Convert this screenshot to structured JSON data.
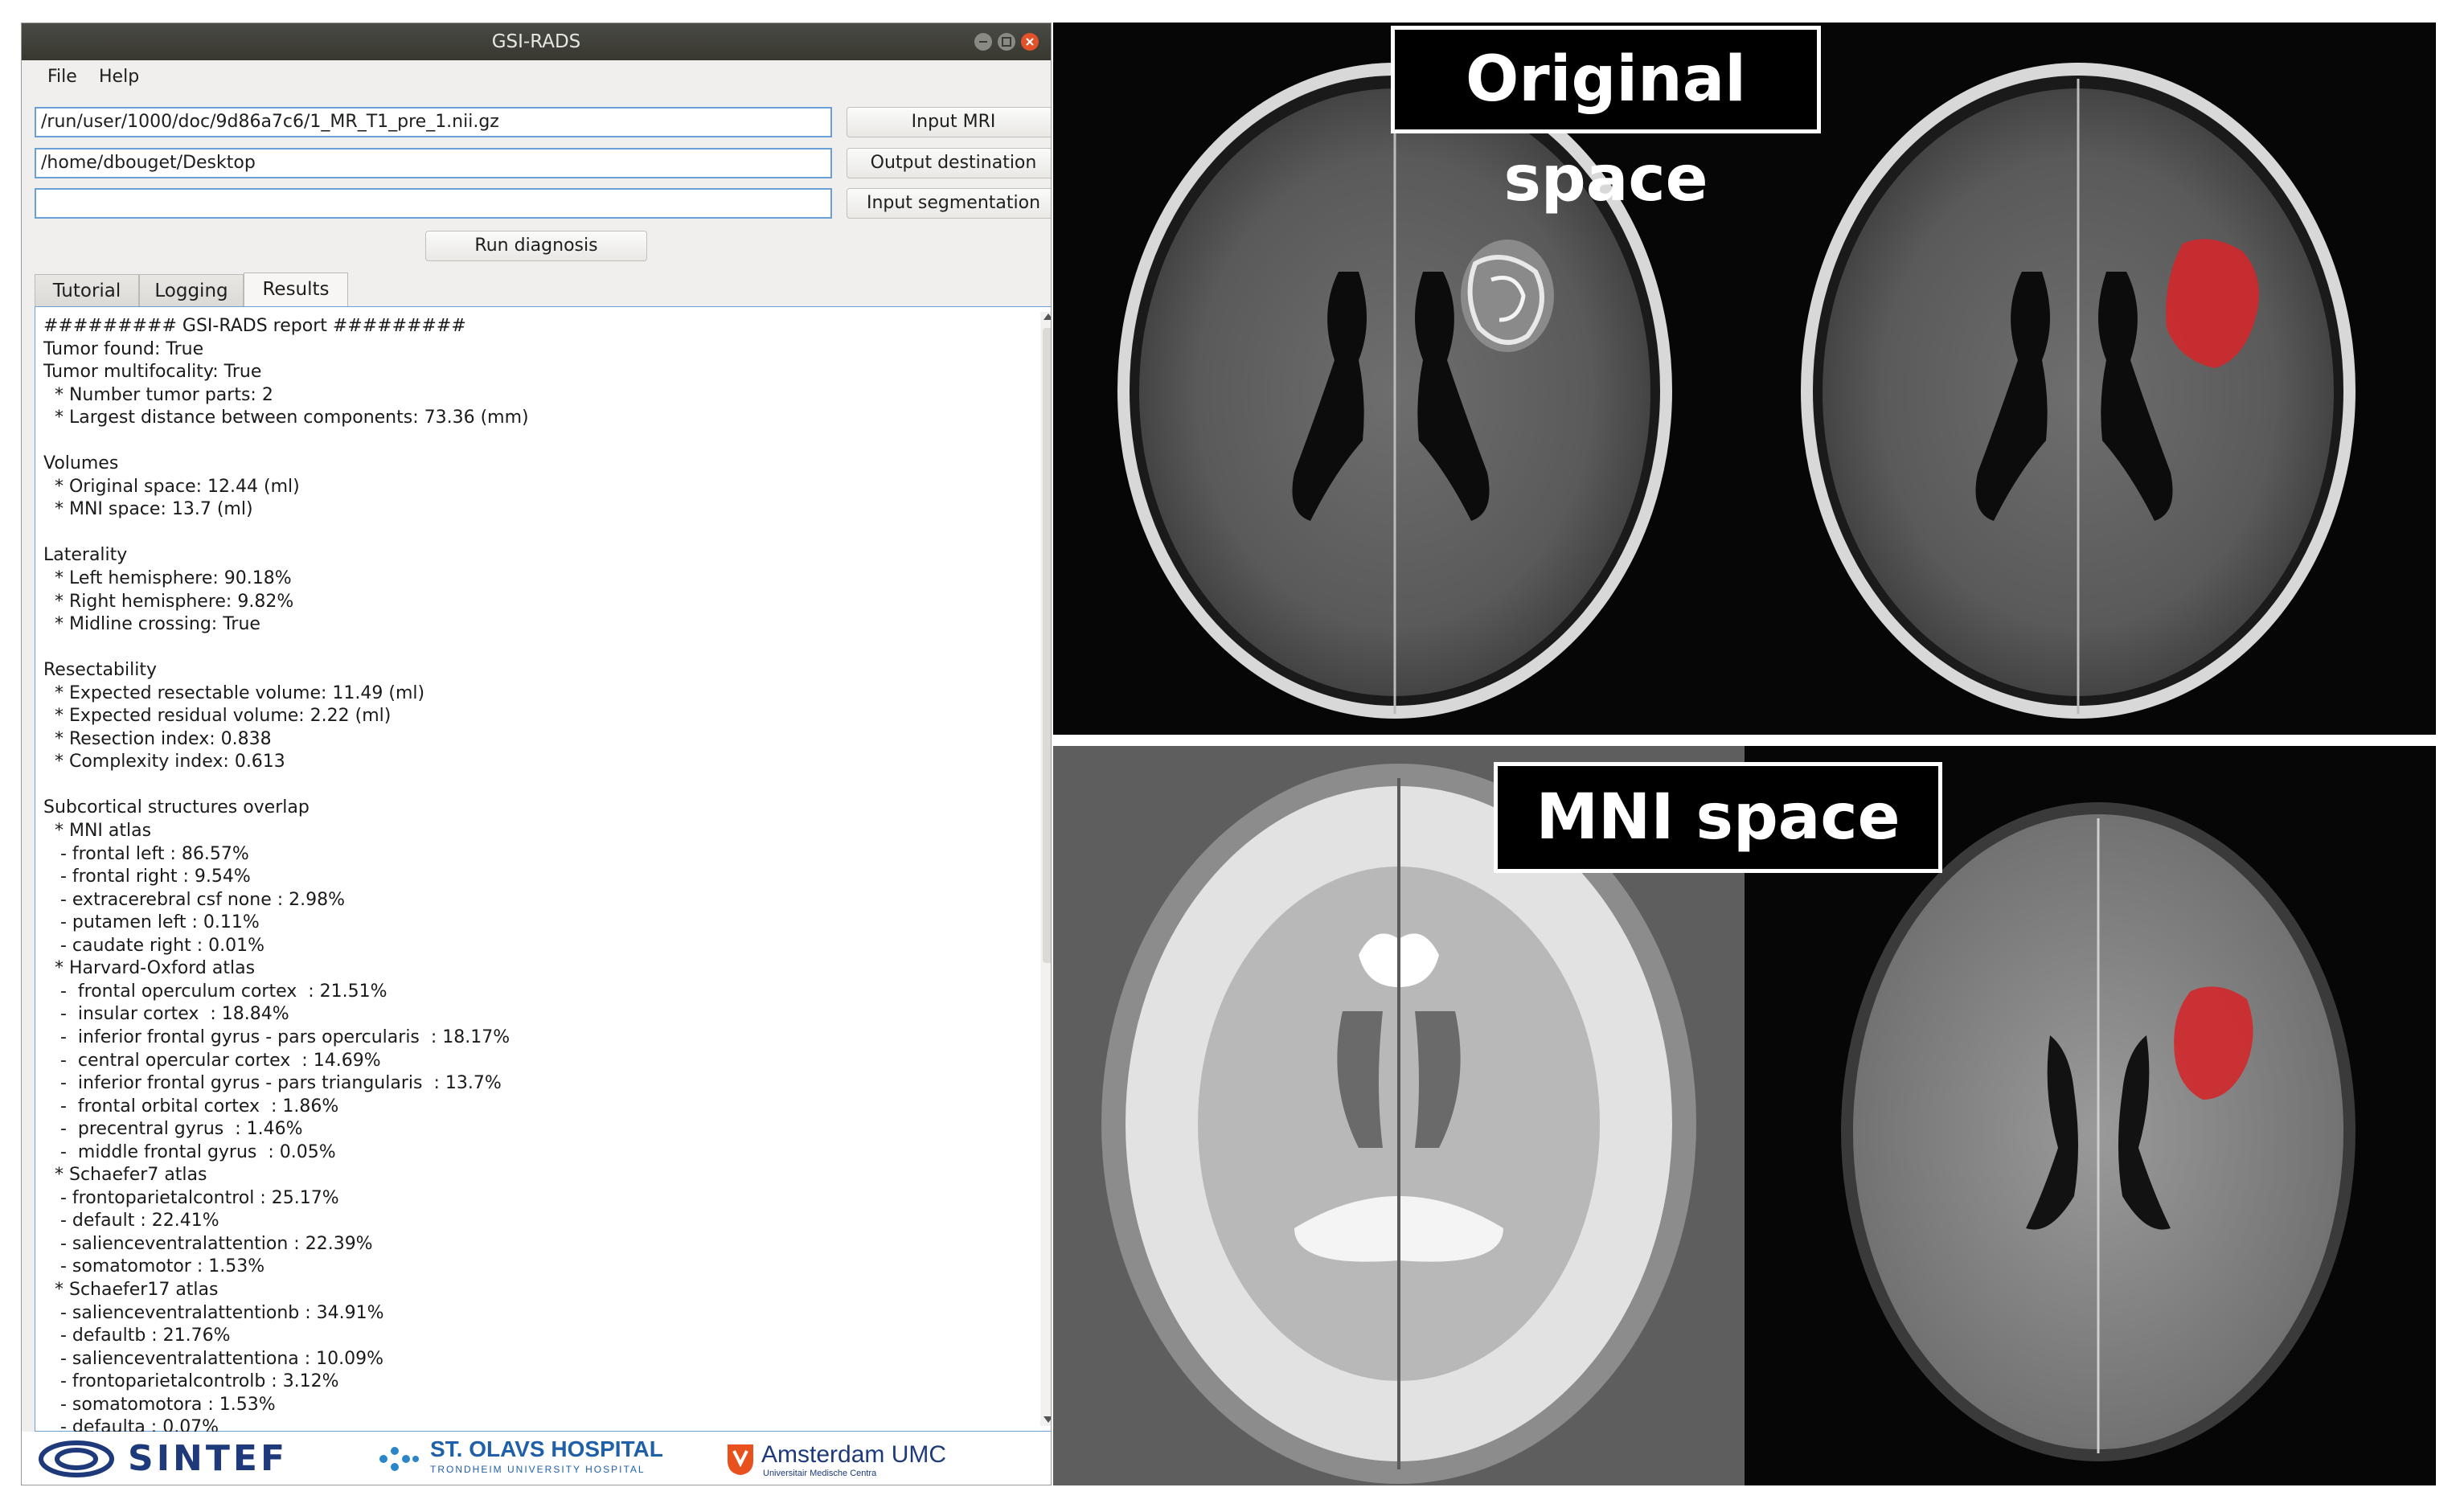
{
  "window": {
    "title": "GSI-RADS"
  },
  "menu": {
    "file": "File",
    "help": "Help"
  },
  "fields": {
    "input_mri_value": "/run/user/1000/doc/9d86a7c6/1_MR_T1_pre_1.nii.gz",
    "output_destination_value": "/home/dbouget/Desktop",
    "input_segmentation_value": ""
  },
  "buttons": {
    "input_mri": "Input MRI",
    "output_destination": "Output destination",
    "input_segmentation": "Input segmentation",
    "run_diagnosis": "Run diagnosis"
  },
  "tabs": {
    "tutorial": "Tutorial",
    "logging": "Logging",
    "results": "Results",
    "active": "Results"
  },
  "report": {
    "text": "######### GSI-RADS report #########\nTumor found: True\nTumor multifocality: True\n  * Number tumor parts: 2\n  * Largest distance between components: 73.36 (mm)\n\nVolumes\n  * Original space: 12.44 (ml)\n  * MNI space: 13.7 (ml)\n\nLaterality\n  * Left hemisphere: 90.18%\n  * Right hemisphere: 9.82%\n  * Midline crossing: True\n\nResectability\n  * Expected resectable volume: 11.49 (ml)\n  * Expected residual volume: 2.22 (ml)\n  * Resection index: 0.838\n  * Complexity index: 0.613\n\nSubcortical structures overlap\n  * MNI atlas\n   - frontal left : 86.57%\n   - frontal right : 9.54%\n   - extracerebral csf none : 2.98%\n   - putamen left : 0.11%\n   - caudate right : 0.01%\n  * Harvard-Oxford atlas\n   -  frontal operculum cortex  : 21.51%\n   -  insular cortex  : 18.84%\n   -  inferior frontal gyrus - pars opercularis  : 18.17%\n   -  central opercular cortex  : 14.69%\n   -  inferior frontal gyrus - pars triangularis  : 13.7%\n   -  frontal orbital cortex  : 1.86%\n   -  precentral gyrus  : 1.46%\n   -  middle frontal gyrus  : 0.05%\n  * Schaefer7 atlas\n   - frontoparietalcontrol : 25.17%\n   - default : 22.41%\n   - salienceventralattention : 22.39%\n   - somatomotor : 1.53%\n  * Schaefer17 atlas\n   - salienceventralattentionb : 34.91%\n   - defaultb : 21.76%\n   - salienceventralattentiona : 10.09%\n   - frontoparietalcontrolb : 3.12%\n   - somatomotora : 1.53%\n   - defaulta : 0.07%"
  },
  "logos": {
    "sintef": "SINTEF",
    "st_olavs": "ST. OLAVS HOSPITAL",
    "st_olavs_sub": "TRONDHEIM UNIVERSITY HOSPITAL",
    "amsterdam": "Amsterdam UMC",
    "amsterdam_sub": "Universitair Medische Centra"
  },
  "images": {
    "original_space_label": "Original space",
    "mni_space_label": "MNI space",
    "tumor_color": "#d0282c"
  }
}
